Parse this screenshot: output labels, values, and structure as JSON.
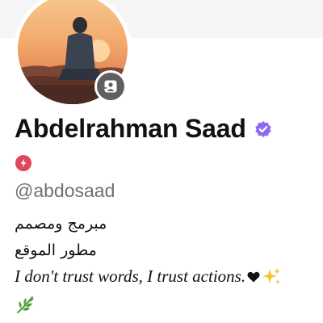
{
  "profile": {
    "display_name": "Abdelrahman Saad",
    "handle": "@abdosaad",
    "verified": true
  },
  "bio": {
    "line1": "مبرمج ومصمم",
    "line2": "مطور الموقع",
    "line3": "I don't trust words, I trust actions."
  },
  "icons": {
    "avatar_badge": "profile-card-icon",
    "verified": "verified-badge-icon",
    "threads": "threads-icon",
    "heart": "black-heart-icon",
    "sparkles": "sparkles-icon",
    "herb": "herb-icon"
  },
  "colors": {
    "verified": "#8b6bf0",
    "threads": "#e2455d",
    "handle": "#707070",
    "text": "#111111",
    "cover": "#f5f5f5"
  }
}
